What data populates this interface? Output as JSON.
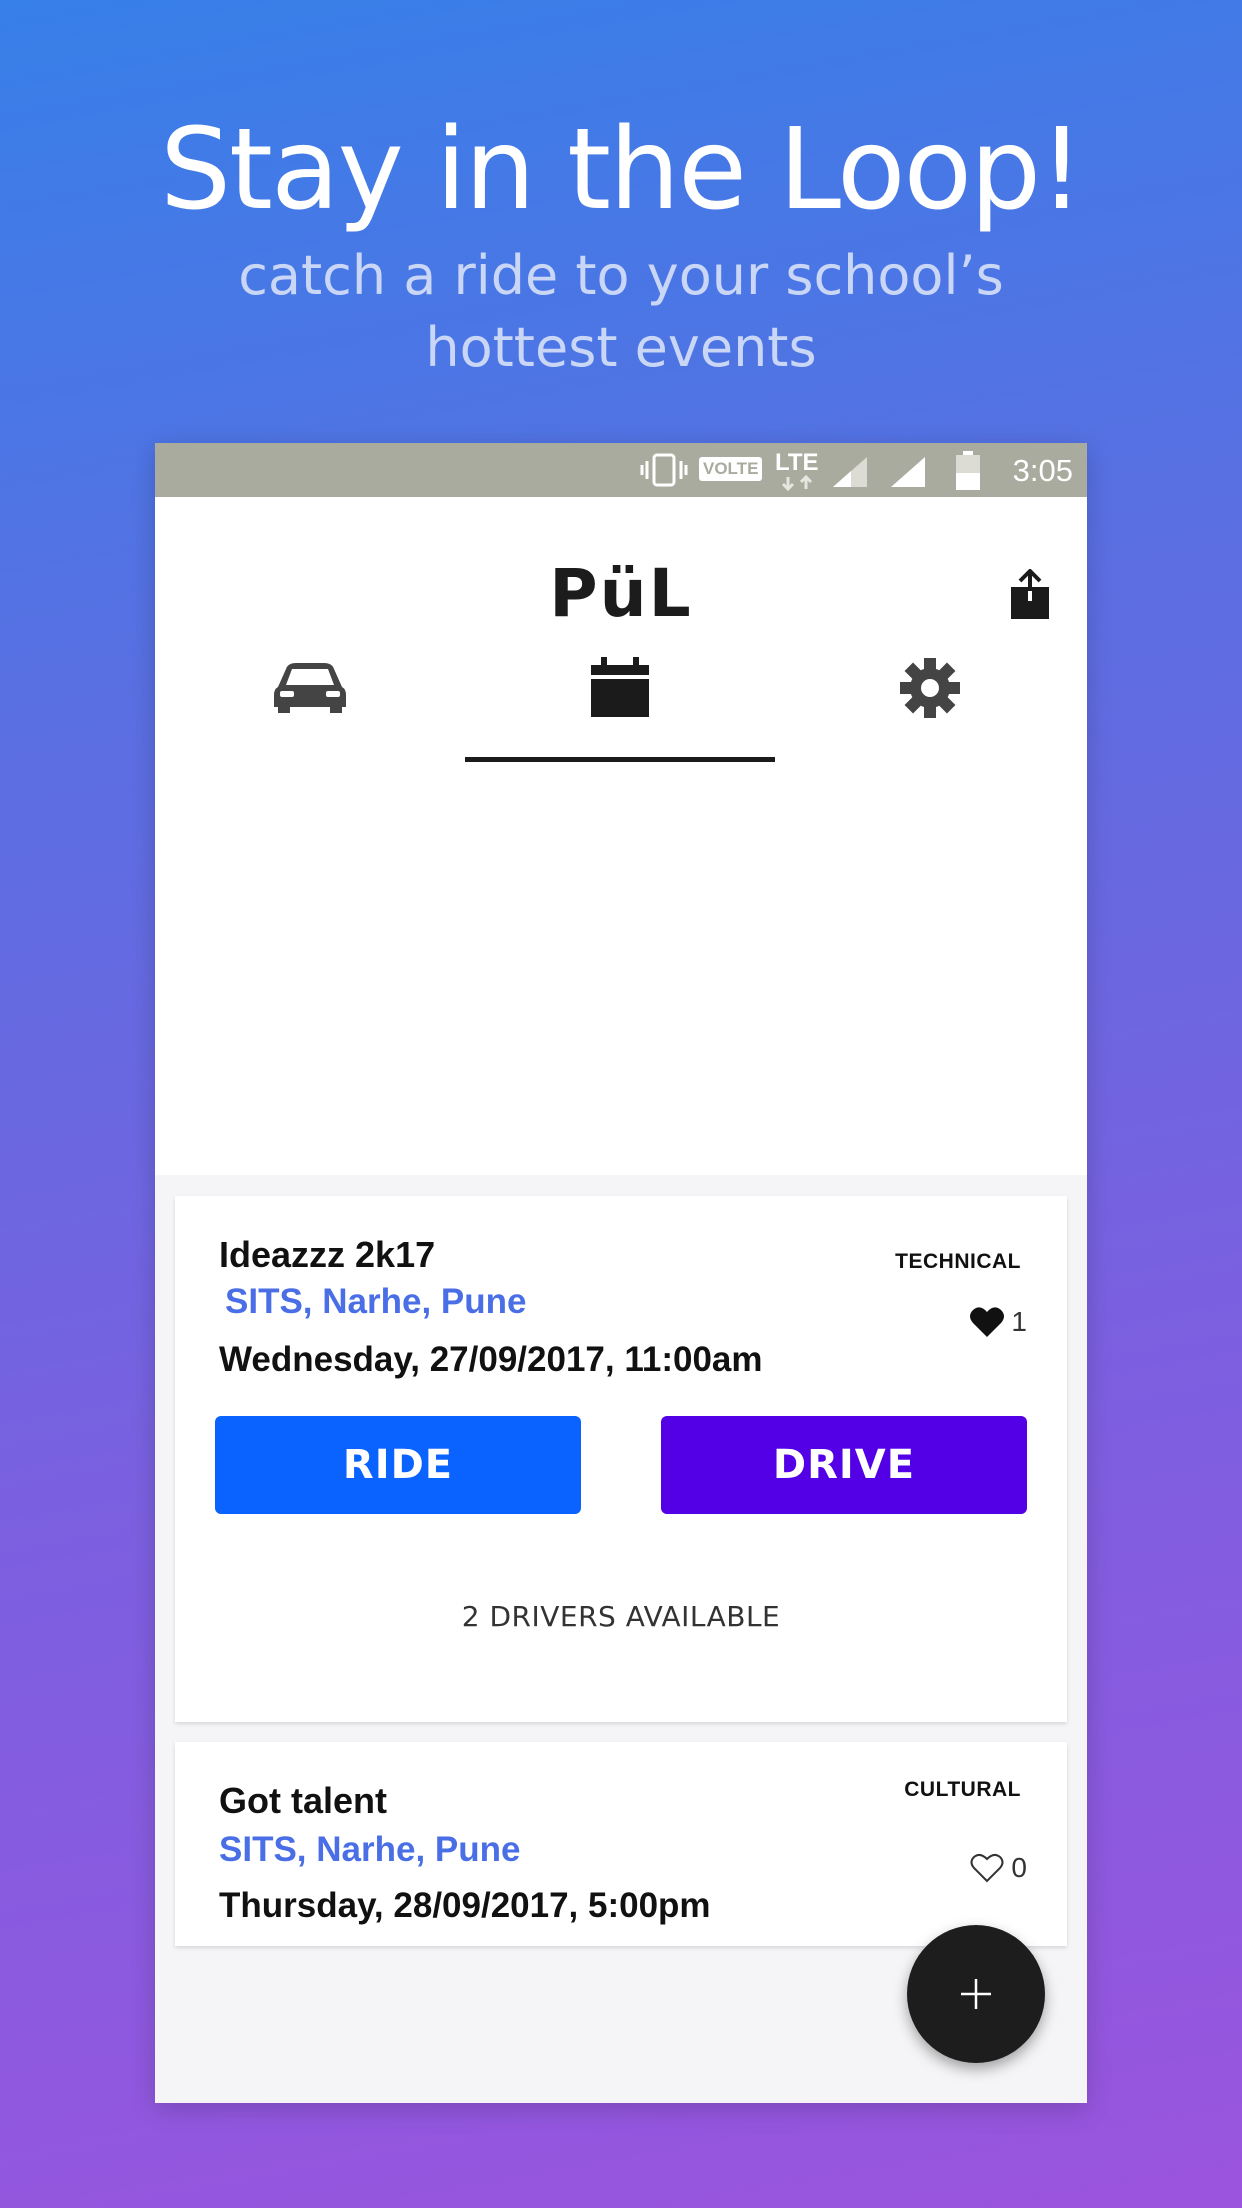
{
  "hero": {
    "title": "Stay in the Loop!",
    "subtitle_line1": "catch a ride to your school’s",
    "subtitle_line2": "hottest events"
  },
  "status_bar": {
    "time": "3:05",
    "network_badge": "VOLTE",
    "network_type": "LTE"
  },
  "app": {
    "logo": "PüL",
    "tabs": [
      {
        "name": "rides",
        "icon": "car-icon"
      },
      {
        "name": "events",
        "icon": "calendar-icon",
        "selected": true
      },
      {
        "name": "settings",
        "icon": "gear-icon"
      }
    ]
  },
  "events": [
    {
      "title": "Ideazzz 2k17",
      "location": "SITS, Narhe, Pune",
      "datetime": "Wednesday, 27/09/2017, 11:00am",
      "category": "TECHNICAL",
      "likes": "1",
      "liked": true,
      "ride_label": "RIDE",
      "drive_label": "DRIVE",
      "drivers_available": "2 DRIVERS AVAILABLE"
    },
    {
      "title": "Got talent",
      "location": "SITS, Narhe, Pune",
      "datetime": "Thursday, 28/09/2017, 5:00pm",
      "category": "CULTURAL",
      "likes": "0",
      "liked": false
    }
  ],
  "colors": {
    "ride_button": "#0a63ff",
    "drive_button": "#5300e6",
    "location_text": "#4a6ee6",
    "fab": "#1d1d1d"
  }
}
